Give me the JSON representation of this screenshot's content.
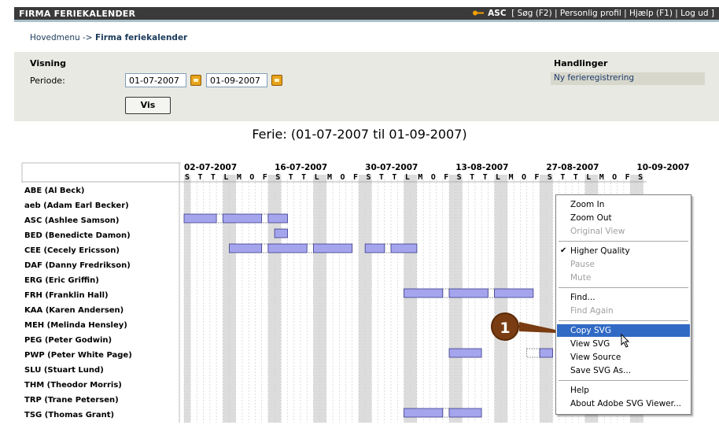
{
  "topbar": {
    "title": "FIRMA FERIEKALENDER",
    "user": "ASC",
    "links": [
      "[ Søg (F2)",
      "Personlig profil",
      "Hjælp (F1)",
      "Log ud ]"
    ]
  },
  "breadcrumb": {
    "root": "Hovedmenu",
    "separator": "->",
    "current": "Firma feriekalender"
  },
  "filter": {
    "section_title": "Visning",
    "periode_label": "Periode:",
    "from_date": "01-07-2007",
    "to_date": "01-09-2007",
    "show_button": "Vis"
  },
  "actions": {
    "section_title": "Handlinger",
    "new_registration": "Ny ferieregistrering"
  },
  "heading": "Ferie: (01-07-2007 til 01-09-2007)",
  "calendar": {
    "week_labels": [
      "02-07-2007",
      "16-07-2007",
      "30-07-2007",
      "13-08-2007",
      "27-08-2007",
      "10-09-2007"
    ],
    "day_letters": [
      "S",
      "T",
      "T",
      "L",
      "M",
      "O",
      "F",
      "S",
      "T",
      "T",
      "L",
      "M",
      "O",
      "F",
      "S",
      "T",
      "T",
      "L",
      "M",
      "O",
      "F",
      "S",
      "T",
      "T",
      "L",
      "M",
      "O",
      "F",
      "S",
      "T",
      "T",
      "L",
      "M",
      "O",
      "F",
      "S"
    ],
    "employees": [
      "ABE (Al Beck)",
      "aeb (Adam Earl Becker)",
      "ASC (Ashlee Samson)",
      "BED (Benedicte Damon)",
      "CEE (Cecely Ericsson)",
      "DAF (Danny Fredrikson)",
      "ERG (Eric Griffin)",
      "FRH (Franklin Hall)",
      "KAA (Karen Andersen)",
      "MEH (Melinda Hensley)",
      "PEG (Peter Godwin)",
      "PWP (Peter White Page)",
      "SLU (Stuart Lund)",
      "THM (Theodor Morris)",
      "TRP (Trane Petersen)",
      "TSG (Thomas Grant)"
    ],
    "vacations": [
      {
        "row": 2,
        "start": 0,
        "end": 5
      },
      {
        "row": 2,
        "start": 6,
        "end": 12
      },
      {
        "row": 2,
        "start": 13,
        "end": 16
      },
      {
        "row": 3,
        "start": 14,
        "end": 16
      },
      {
        "row": 4,
        "start": 7,
        "end": 12
      },
      {
        "row": 4,
        "start": 13,
        "end": 19
      },
      {
        "row": 4,
        "start": 20,
        "end": 26
      },
      {
        "row": 4,
        "start": 28,
        "end": 31
      },
      {
        "row": 4,
        "start": 32,
        "end": 36
      },
      {
        "row": 7,
        "start": 34,
        "end": 40
      },
      {
        "row": 7,
        "start": 41,
        "end": 47
      },
      {
        "row": 7,
        "start": 48,
        "end": 54
      },
      {
        "row": 11,
        "start": 41,
        "end": 46
      },
      {
        "row": 11,
        "start": 55,
        "end": 57
      },
      {
        "row": 15,
        "start": 34,
        "end": 40
      },
      {
        "row": 15,
        "start": 41,
        "end": 46
      }
    ],
    "gaps": [
      {
        "row": 2,
        "start": 5,
        "end": 6
      },
      {
        "row": 2,
        "start": 12,
        "end": 13
      },
      {
        "row": 4,
        "start": 12,
        "end": 13
      },
      {
        "row": 4,
        "start": 19,
        "end": 20
      },
      {
        "row": 4,
        "start": 31,
        "end": 32
      },
      {
        "row": 7,
        "start": 40,
        "end": 41
      },
      {
        "row": 7,
        "start": 47,
        "end": 48
      },
      {
        "row": 11,
        "start": 53,
        "end": 55
      },
      {
        "row": 15,
        "start": 40,
        "end": 41
      }
    ]
  },
  "context_menu": {
    "items": [
      {
        "label": "Zoom In",
        "disabled": false
      },
      {
        "label": "Zoom Out",
        "disabled": false
      },
      {
        "label": "Original View",
        "disabled": true
      },
      {
        "sep": true
      },
      {
        "label": "Higher Quality",
        "disabled": false,
        "checked": true
      },
      {
        "label": "Pause",
        "disabled": true
      },
      {
        "label": "Mute",
        "disabled": true
      },
      {
        "sep": true
      },
      {
        "label": "Find...",
        "disabled": false
      },
      {
        "label": "Find Again",
        "disabled": true
      },
      {
        "sep": true
      },
      {
        "label": "Copy SVG",
        "disabled": false,
        "active": true
      },
      {
        "label": "View SVG",
        "disabled": false
      },
      {
        "label": "View Source",
        "disabled": false
      },
      {
        "label": "Save SVG As...",
        "disabled": false
      },
      {
        "sep": true
      },
      {
        "label": "Help",
        "disabled": false
      },
      {
        "label": "About Adobe SVG Viewer...",
        "disabled": false
      }
    ]
  },
  "callout": {
    "number": "1"
  },
  "colors": {
    "bar_fill": "#a5a5ee",
    "bar_stroke": "#3a3a8a",
    "weekend_band": "#dcdcdc",
    "menu_highlight": "#316ac5",
    "callout": "#7a3c12",
    "topbar": "#3a3a3a"
  }
}
